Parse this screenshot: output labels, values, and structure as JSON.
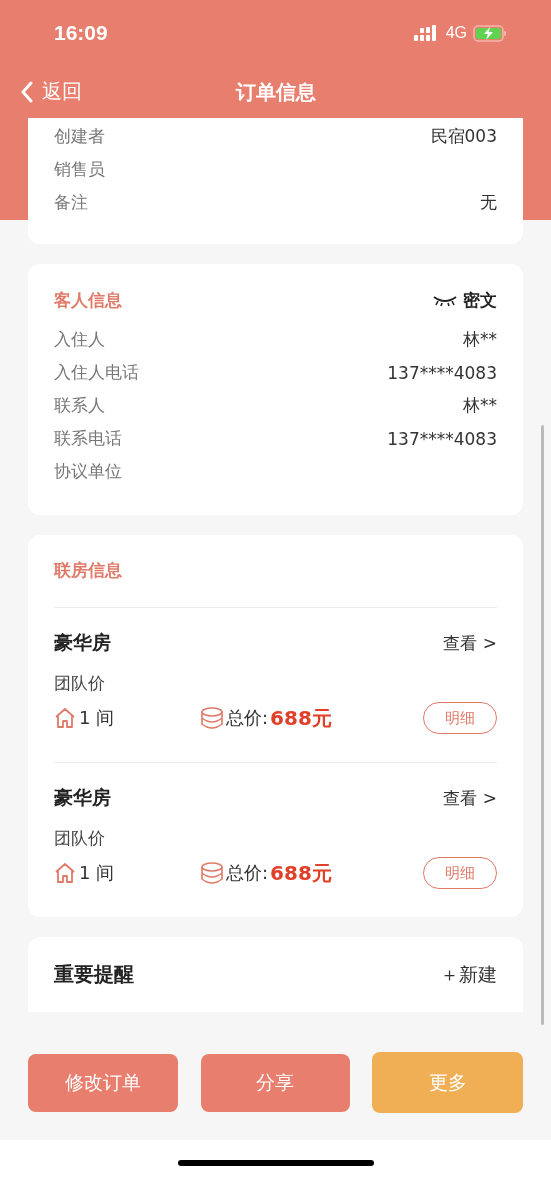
{
  "status_bar": {
    "time": "16:09",
    "network": "4G"
  },
  "nav": {
    "back": "返回",
    "title": "订单信息"
  },
  "order_card": {
    "rows": [
      {
        "label": "创建者",
        "value": "民宿003"
      },
      {
        "label": "销售员"
      },
      {
        "label": "备注",
        "value": "无"
      }
    ]
  },
  "guest_card": {
    "title": "客人信息",
    "privacy_toggle": {
      "label": "密文",
      "hidden": true
    },
    "rows": [
      {
        "label": "入住人",
        "value": "林**"
      },
      {
        "label": "入住人电话",
        "value": "137****4083"
      },
      {
        "label": "联系人",
        "value": "林**"
      },
      {
        "label": "联系电话",
        "value": "137****4083"
      },
      {
        "label": "协议单位"
      }
    ]
  },
  "rooms_card": {
    "title": "联房信息",
    "rooms": [
      {
        "name": "豪华房",
        "view_link": "查看 >",
        "rate": "团队价",
        "count": "1 间",
        "total_label": "总价:",
        "total": "688元",
        "detail_button": "明细"
      },
      {
        "name": "豪华房",
        "view_link": "查看 >",
        "rate": "团队价",
        "count": "1 间",
        "total_label": "总价:",
        "total": "688元",
        "detail_button": "明细"
      }
    ]
  },
  "reminder_card": {
    "title": "重要提醒",
    "new_button": "＋新建"
  },
  "actions": [
    {
      "label": "修改订单",
      "kind": "primary"
    },
    {
      "label": "分享",
      "kind": "primary"
    },
    {
      "label": "更多",
      "kind": "secondary"
    }
  ]
}
